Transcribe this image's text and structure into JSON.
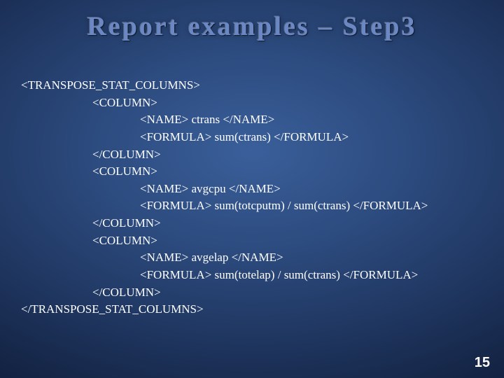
{
  "title": "Report examples – Step3",
  "code": {
    "l1": "<TRANSPOSE_STAT_COLUMNS>",
    "l2": "                        <COLUMN>",
    "l3": "                                        <NAME> ctrans </NAME>",
    "l4": "                                        <FORMULA> sum(ctrans) </FORMULA>",
    "l5": "                        </COLUMN>",
    "l6": "                        <COLUMN>",
    "l7": "                                        <NAME> avgcpu </NAME>",
    "l8": "                                        <FORMULA> sum(totcputm) / sum(ctrans) </FORMULA>",
    "l9": "                        </COLUMN>",
    "l10": "                        <COLUMN>",
    "l11": "                                        <NAME> avgelap </NAME>",
    "l12": "                                        <FORMULA> sum(totelap) / sum(ctrans) </FORMULA>",
    "l13": "                        </COLUMN>",
    "l14": "</TRANSPOSE_STAT_COLUMNS>"
  },
  "page_number": "15"
}
